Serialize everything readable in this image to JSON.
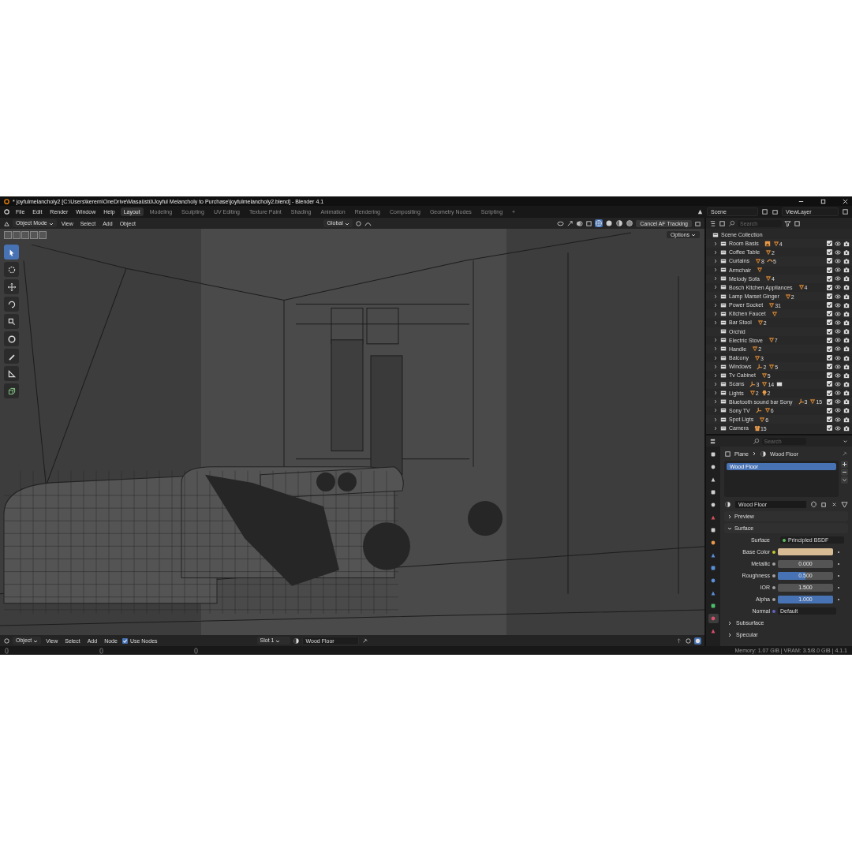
{
  "window": {
    "title": "* joyfulmelancholy2 [C:\\Users\\kerem\\OneDrive\\Masaüstü\\Joyful Melancholy to Purchase\\joyfulmelancholy2.blend] - Blender 4.1"
  },
  "menu": [
    "File",
    "Edit",
    "Render",
    "Window",
    "Help"
  ],
  "workspaces": [
    {
      "label": "Layout",
      "selected": true
    },
    {
      "label": "Modeling",
      "selected": false
    },
    {
      "label": "Sculpting",
      "selected": false
    },
    {
      "label": "UV Editing",
      "selected": false
    },
    {
      "label": "Texture Paint",
      "selected": false
    },
    {
      "label": "Shading",
      "selected": false
    },
    {
      "label": "Animation",
      "selected": false
    },
    {
      "label": "Rendering",
      "selected": false
    },
    {
      "label": "Compositing",
      "selected": false
    },
    {
      "label": "Geometry Nodes",
      "selected": false
    },
    {
      "label": "Scripting",
      "selected": false
    }
  ],
  "add_workspace": "+",
  "scene_field": {
    "value": "Scene"
  },
  "view_layer_field": {
    "value": "ViewLayer"
  },
  "viewport_header": {
    "mode": "Object Mode",
    "menus": [
      "View",
      "Select",
      "Add",
      "Object"
    ],
    "orientation": "Global",
    "shading": [
      {
        "kind": "wireframe",
        "selected": true
      },
      {
        "kind": "solid",
        "selected": false
      },
      {
        "kind": "material",
        "selected": false
      },
      {
        "kind": "rendered",
        "selected": false
      }
    ],
    "tracking_button": "Cancel AF Tracking"
  },
  "viewport": {
    "options_button": "Options",
    "tools": [
      {
        "kind": "select",
        "selected": true
      },
      {
        "kind": "cursor",
        "selected": false
      },
      {
        "kind": "move",
        "selected": false
      },
      {
        "kind": "rotate",
        "selected": false
      },
      {
        "kind": "scale",
        "selected": false
      },
      {
        "kind": "transform",
        "selected": false
      },
      {
        "kind": "annotate",
        "selected": false
      },
      {
        "kind": "measure",
        "selected": false
      },
      {
        "kind": "add-cube",
        "selected": false
      }
    ]
  },
  "outliner": {
    "search": {
      "placeholder": "Search"
    },
    "root": "Scene Collection",
    "items": [
      {
        "name": "Room Basis",
        "expandable": true,
        "checked": true,
        "badges": [
          {
            "kind": "image"
          },
          {
            "kind": "mesh",
            "count": "4"
          }
        ]
      },
      {
        "name": "Coffee Table",
        "expandable": true,
        "checked": true,
        "badges": [
          {
            "kind": "mesh",
            "count": "2"
          }
        ]
      },
      {
        "name": "Curtains",
        "expandable": true,
        "checked": true,
        "badges": [
          {
            "kind": "mesh",
            "count": "8"
          },
          {
            "kind": "curve",
            "count": "5"
          }
        ]
      },
      {
        "name": "Armchair",
        "expandable": true,
        "checked": true,
        "badges": [
          {
            "kind": "mesh"
          }
        ]
      },
      {
        "name": "Melody Sofa",
        "expandable": true,
        "checked": true,
        "badges": [
          {
            "kind": "mesh",
            "count": "4"
          }
        ]
      },
      {
        "name": "Bosch Kitchen Appliances",
        "expandable": true,
        "checked": true,
        "badges": [
          {
            "kind": "mesh",
            "count": "4"
          }
        ]
      },
      {
        "name": "Lamp Marset Ginger",
        "expandable": true,
        "checked": true,
        "badges": [
          {
            "kind": "mesh",
            "count": "2"
          }
        ]
      },
      {
        "name": "Power Socket",
        "expandable": true,
        "checked": true,
        "badges": [
          {
            "kind": "mesh",
            "count": "31"
          }
        ]
      },
      {
        "name": "Kitchen Faucet",
        "expandable": true,
        "checked": true,
        "badges": [
          {
            "kind": "mesh"
          }
        ]
      },
      {
        "name": "Bar Stool",
        "expandable": true,
        "checked": true,
        "badges": [
          {
            "kind": "mesh",
            "count": "2"
          }
        ]
      },
      {
        "name": "Orchid",
        "expandable": false,
        "checked": true
      },
      {
        "name": "Electric Stove",
        "expandable": true,
        "checked": true,
        "badges": [
          {
            "kind": "mesh",
            "count": "7"
          }
        ]
      },
      {
        "name": "Handle",
        "expandable": true,
        "checked": true,
        "badges": [
          {
            "kind": "mesh",
            "count": "2"
          }
        ]
      },
      {
        "name": "Balcony",
        "expandable": true,
        "checked": true,
        "badges": [
          {
            "kind": "mesh",
            "count": "3"
          }
        ]
      },
      {
        "name": "Windows",
        "expandable": true,
        "checked": true,
        "badges": [
          {
            "kind": "empty",
            "count": "2"
          },
          {
            "kind": "mesh",
            "count": "5"
          }
        ]
      },
      {
        "name": "Tv Cabinet",
        "expandable": true,
        "checked": true,
        "badges": [
          {
            "kind": "mesh",
            "count": "5"
          }
        ]
      },
      {
        "name": "Scans",
        "expandable": true,
        "checked": true,
        "badges": [
          {
            "kind": "empty",
            "count": "3"
          },
          {
            "kind": "mesh",
            "count": "14"
          },
          {
            "kind": "collection"
          }
        ]
      },
      {
        "name": "Lights",
        "expandable": true,
        "checked": true,
        "badges": [
          {
            "kind": "mesh",
            "count": "2"
          },
          {
            "kind": "light",
            "count": "2"
          }
        ]
      },
      {
        "name": "Bluetooth sound bar Sony",
        "expandable": true,
        "checked": true,
        "badges": [
          {
            "kind": "empty",
            "count": "3"
          },
          {
            "kind": "mesh",
            "count": "15"
          }
        ]
      },
      {
        "name": "Sony TV",
        "expandable": true,
        "checked": true,
        "badges": [
          {
            "kind": "empty"
          },
          {
            "kind": "mesh",
            "count": "6"
          }
        ]
      },
      {
        "name": "Spot Ligts",
        "expandable": true,
        "checked": true,
        "badges": [
          {
            "kind": "mesh",
            "count": "6"
          }
        ]
      },
      {
        "name": "Camera",
        "expandable": true,
        "checked": true,
        "badges": [
          {
            "kind": "camera",
            "count": "15"
          }
        ]
      }
    ]
  },
  "properties": {
    "search": {
      "placeholder": "Search"
    },
    "tabs": [
      {
        "kind": "tool",
        "selected": false
      },
      {
        "kind": "render",
        "selected": false
      },
      {
        "kind": "output",
        "selected": false
      },
      {
        "kind": "view-layer",
        "selected": false
      },
      {
        "kind": "scene",
        "selected": false
      },
      {
        "kind": "world",
        "selected": false
      },
      {
        "kind": "collection",
        "selected": false
      },
      {
        "kind": "object",
        "selected": false
      },
      {
        "kind": "modifier",
        "selected": false
      },
      {
        "kind": "particles",
        "selected": false
      },
      {
        "kind": "physics",
        "selected": false
      },
      {
        "kind": "constraints",
        "selected": false
      },
      {
        "kind": "data",
        "selected": false
      },
      {
        "kind": "material",
        "selected": true
      },
      {
        "kind": "texture",
        "selected": false
      }
    ],
    "breadcrumb": [
      "Plane",
      "Wood Floor"
    ],
    "slots": [
      {
        "name": "Wood Floor",
        "selected": true
      }
    ],
    "material_field": {
      "value": "Wood Floor"
    },
    "panels": [
      {
        "label": "Preview",
        "expanded": false
      },
      {
        "label": "Surface",
        "expanded": true
      }
    ],
    "surface": {
      "label": "Surface",
      "value": "Principled BSDF"
    },
    "inputs": [
      {
        "kind": "color",
        "label": "Base Color",
        "color": "#d8bc94"
      },
      {
        "kind": "slider",
        "label": "Metallic",
        "value": "0.000",
        "level": 0
      },
      {
        "kind": "slider",
        "label": "Roughness",
        "value": "0.500",
        "level": 0.5
      },
      {
        "kind": "number",
        "label": "IOR",
        "value": "1.500"
      },
      {
        "kind": "slider",
        "label": "Alpha",
        "value": "1.000",
        "level": 1
      },
      {
        "kind": "link",
        "label": "Normal",
        "value": "Default"
      }
    ],
    "subpanels": [
      {
        "label": "Subsurface",
        "expanded": false
      },
      {
        "label": "Specular",
        "expanded": false
      }
    ]
  },
  "node_header": {
    "object_mode": "Object",
    "menus": [
      "View",
      "Select",
      "Add",
      "Node"
    ],
    "use_nodes": {
      "label": "Use Nodes",
      "checked": true
    },
    "slot": "Slot 1",
    "material": "Wood Floor"
  },
  "status_bar": {
    "text": "Memory: 1.07 GiB | VRAM: 3.5/8.0 GiB | 4.1.1"
  }
}
